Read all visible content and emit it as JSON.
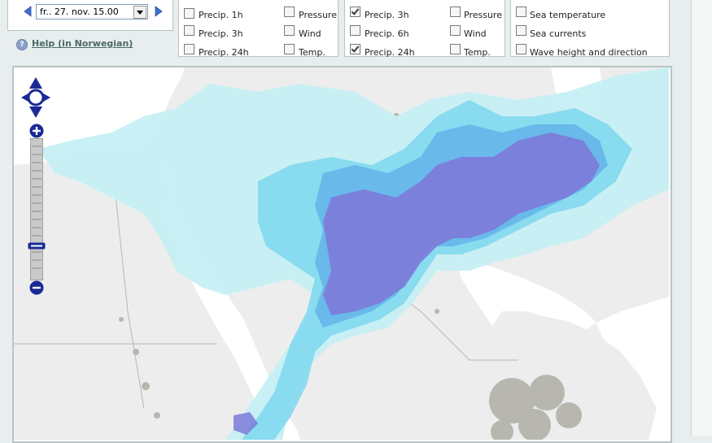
{
  "date_selector": {
    "value": "fr.. 27. nov. 15.00"
  },
  "help": {
    "icon": "?",
    "label": "Help (in Norwegian)"
  },
  "panels": [
    {
      "items": [
        {
          "label": "Precip. 1h",
          "checked": false
        },
        {
          "label": "Pressure",
          "checked": false
        },
        {
          "label": "Precip. 3h",
          "checked": false
        },
        {
          "label": "Wind",
          "checked": false
        },
        {
          "label": "Precip. 24h",
          "checked": false
        },
        {
          "label": "Temp.",
          "checked": false
        }
      ]
    },
    {
      "items": [
        {
          "label": "Precip. 3h",
          "checked": true
        },
        {
          "label": "Pressure",
          "checked": false
        },
        {
          "label": "Precip. 6h",
          "checked": false
        },
        {
          "label": "Wind",
          "checked": false
        },
        {
          "label": "Precip. 24h",
          "checked": true
        },
        {
          "label": "Temp.",
          "checked": false
        }
      ]
    },
    {
      "items": [
        {
          "label": "Sea temperature",
          "checked": false
        },
        {
          "label": "Sea currents",
          "checked": false
        },
        {
          "label": "Wave height and direction",
          "checked": false
        }
      ]
    }
  ],
  "map": {
    "zoom_level_fraction": 0.72,
    "colors": {
      "land": "#ededed",
      "water": "#ffffff",
      "terrain": "#a8a8a0",
      "precip_light": "#c6f0f4",
      "precip_medium": "#82d8ee",
      "precip_heavy": "#4f9ce8",
      "precip_extreme": "#7d7ad8",
      "control_blue": "#1a2a94"
    }
  }
}
